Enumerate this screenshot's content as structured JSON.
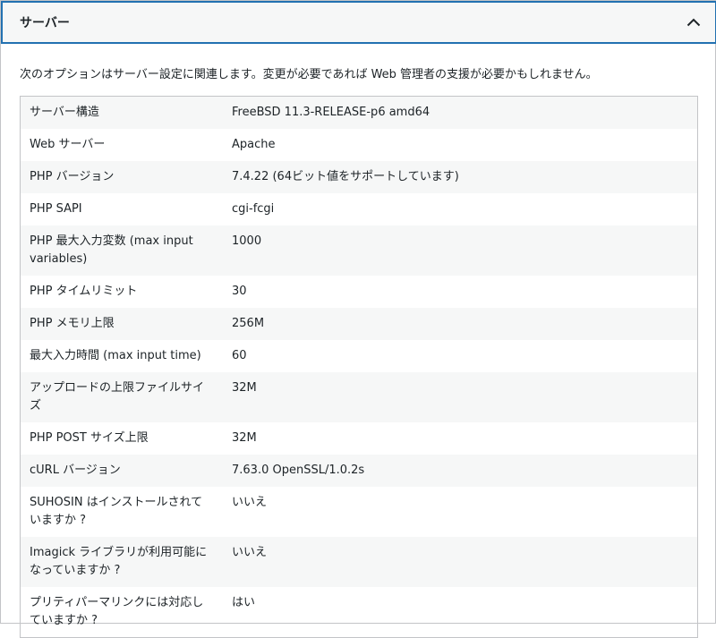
{
  "section": {
    "title": "サーバー",
    "description": "次のオプションはサーバー設定に関連します。変更が必要であれば Web 管理者の支援が必要かもしれません。",
    "toggle_icon": "chevron-up-icon"
  },
  "rows": [
    {
      "label": "サーバー構造",
      "value": "FreeBSD 11.3-RELEASE-p6 amd64"
    },
    {
      "label": "Web サーバー",
      "value": "Apache"
    },
    {
      "label": "PHP バージョン",
      "value": "7.4.22 (64ビット値をサポートしています)"
    },
    {
      "label": "PHP SAPI",
      "value": "cgi-fcgi"
    },
    {
      "label": "PHP 最大入力変数 (max input variables)",
      "value": "1000"
    },
    {
      "label": "PHP タイムリミット",
      "value": "30"
    },
    {
      "label": "PHP メモリ上限",
      "value": "256M"
    },
    {
      "label": "最大入力時間 (max input time)",
      "value": "60"
    },
    {
      "label": "アップロードの上限ファイルサイズ",
      "value": "32M"
    },
    {
      "label": "PHP POST サイズ上限",
      "value": "32M"
    },
    {
      "label": "cURL バージョン",
      "value": "7.63.0 OpenSSL/1.0.2s"
    },
    {
      "label": "SUHOSIN はインストールされていますか ?",
      "value": "いいえ"
    },
    {
      "label": "Imagick ライブラリが利用可能になっていますか ?",
      "value": "いいえ"
    },
    {
      "label": "プリティパーマリンクには対応していますか ?",
      "value": "はい"
    }
  ]
}
